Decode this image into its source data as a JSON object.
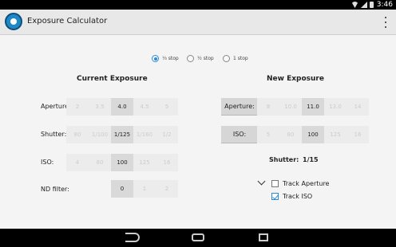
{
  "status_bar": {
    "time": "3:46"
  },
  "app": {
    "title": "Exposure Calculator"
  },
  "step_options": [
    {
      "label": "⅓ stop",
      "checked": true
    },
    {
      "label": "½ stop",
      "checked": false
    },
    {
      "label": "1 stop",
      "checked": false
    }
  ],
  "current": {
    "title": "Current Exposure",
    "aperture": {
      "label": "Aperture:",
      "values": [
        "2",
        "3.5",
        "4.0",
        "4.5",
        "5"
      ],
      "selected": "4.0"
    },
    "shutter": {
      "label": "Shutter:",
      "values": [
        "80",
        "1/100",
        "1/125",
        "1/160",
        "1/2"
      ],
      "selected": "1/125"
    },
    "iso": {
      "label": "ISO:",
      "values": [
        "4",
        "80",
        "100",
        "125",
        "16"
      ],
      "selected": "100"
    },
    "nd": {
      "label": "ND filter:",
      "values": [
        "0",
        "1",
        "2"
      ],
      "selected": "0"
    }
  },
  "new": {
    "title": "New Exposure",
    "aperture": {
      "label": "Aperture:",
      "values": [
        "8",
        "10.0",
        "11.0",
        "13.0",
        "14"
      ],
      "selected": "11.0"
    },
    "iso": {
      "label": "ISO:",
      "values": [
        "5",
        "80",
        "100",
        "125",
        "16"
      ],
      "selected": "100"
    },
    "shutter_result": {
      "label": "Shutter:",
      "value": "1/15"
    },
    "track_aperture": {
      "label": "Track Aperture",
      "checked": false
    },
    "track_iso": {
      "label": "Track ISO",
      "checked": true
    }
  }
}
